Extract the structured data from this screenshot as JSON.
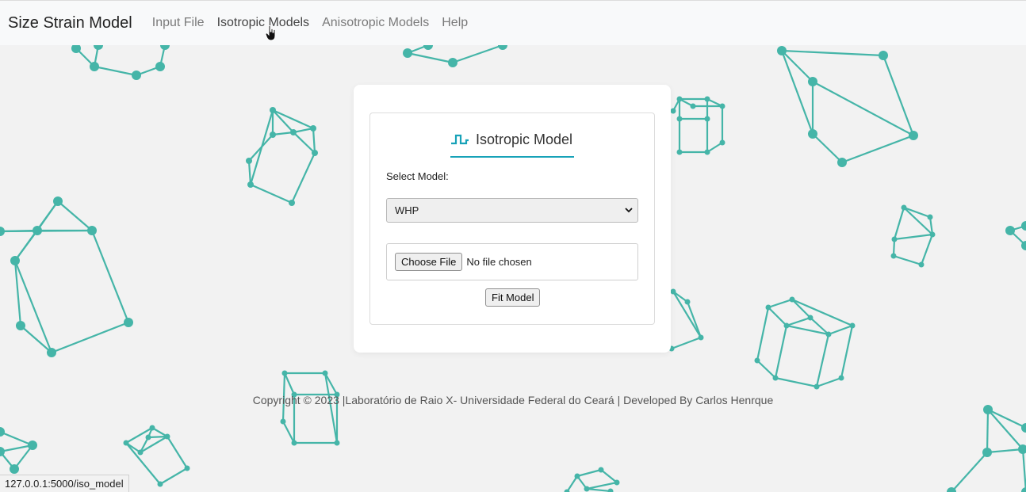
{
  "navbar": {
    "brand": "Size Strain Model",
    "links": [
      "Input File",
      "Isotropic Models",
      "Anisotropic Models",
      "Help"
    ],
    "active_link": "Isotropic Models"
  },
  "card": {
    "title": "Isotropic Model",
    "title_icon": "waveform-icon",
    "select_label": "Select Model:",
    "select_value": "WHP",
    "choose_file_label": "Choose File",
    "file_status": "No file chosen",
    "fit_button_label": "Fit Model"
  },
  "footer": {
    "text": "Copyright © 2023 |Laboratório de Raio X- Universidade Federal do Ceará | Developed By Carlos Henrque"
  },
  "status_bar": {
    "url": "127.0.0.1:5000/iso_model"
  },
  "colors": {
    "accent": "#17a2b8",
    "crystal": "#45b5a8",
    "background": "#f2f2f2",
    "navbar": "#f8f9fa"
  }
}
